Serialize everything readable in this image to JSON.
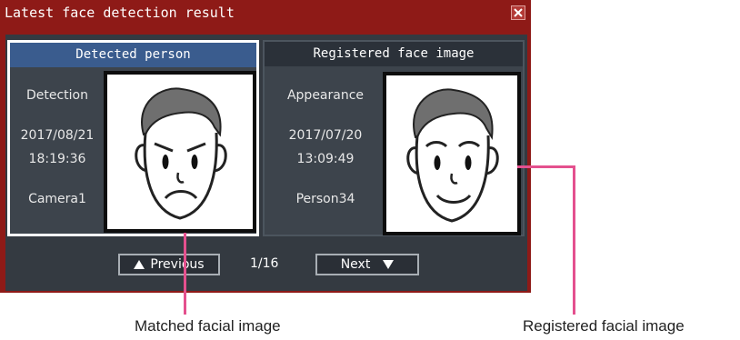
{
  "dialog": {
    "title": "Latest face detection result",
    "close_icon": "close-icon"
  },
  "detected_panel": {
    "header": "Detected person",
    "label": "Detection",
    "date": "2017/08/21",
    "time": "18:19:36",
    "source": "Camera1"
  },
  "registered_panel": {
    "header": "Registered face image",
    "label": "Appearance",
    "date": "2017/07/20",
    "time": "13:09:49",
    "source": "Person34"
  },
  "navigation": {
    "previous_label": "Previous",
    "next_label": "Next",
    "page_indicator": "1/16",
    "previous_icon": "triangle-up-icon",
    "next_icon": "triangle-down-icon"
  },
  "captions": {
    "matched": "Matched facial image",
    "registered": "Registered facial image"
  },
  "colors": {
    "title_bar": "#8e1a17",
    "active_header": "#3a5c8e",
    "callout": "#e4508e"
  }
}
